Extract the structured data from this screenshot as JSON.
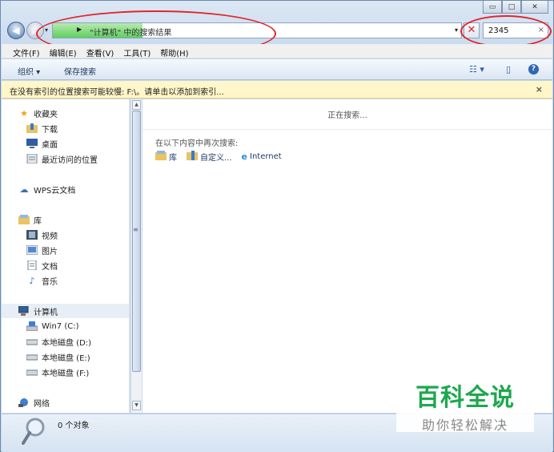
{
  "window": {
    "caption_minimize": "▭",
    "caption_maximize": "□",
    "caption_close": "✕"
  },
  "address_bar": {
    "path_text": "\"计算机\" 中的搜索结果",
    "breadcrumb_arrow": "▶",
    "dropdown": "▾",
    "stop_glyph": "✕",
    "progress_fraction": 0.22
  },
  "search": {
    "value": "2345",
    "clear_glyph": "×"
  },
  "menubar": {
    "items": [
      {
        "label": "文件(F)"
      },
      {
        "label": "编辑(E)"
      },
      {
        "label": "查看(V)"
      },
      {
        "label": "工具(T)"
      },
      {
        "label": "帮助(H)"
      }
    ]
  },
  "commandbar": {
    "organize": "组织 ▾",
    "save_search": "保存搜索",
    "view_glyph": "☷ ▾",
    "pane_glyph": "▯",
    "help_glyph": "?"
  },
  "infobar": {
    "text": "在没有索引的位置搜索可能较慢: F:\\。请单击以添加到索引...",
    "close": "×"
  },
  "nav_pane": {
    "favorites": {
      "label": "收藏夹",
      "icon": "star-icon"
    },
    "favorite_items": [
      {
        "label": "下载",
        "icon": "downloads-folder-icon"
      },
      {
        "label": "桌面",
        "icon": "desktop-icon"
      },
      {
        "label": "最近访问的位置",
        "icon": "recent-places-icon"
      }
    ],
    "wps": {
      "label": "WPS云文档",
      "icon": "cloud-icon"
    },
    "library": {
      "label": "库",
      "icon": "library-icon"
    },
    "library_items": [
      {
        "label": "视频",
        "icon": "video-library-icon"
      },
      {
        "label": "图片",
        "icon": "pictures-library-icon"
      },
      {
        "label": "文档",
        "icon": "documents-library-icon"
      },
      {
        "label": "音乐",
        "icon": "music-library-icon"
      }
    ],
    "computer": {
      "label": "计算机",
      "icon": "computer-icon"
    },
    "drives": [
      {
        "label": "Win7 (C:)",
        "icon": "system-drive-icon"
      },
      {
        "label": "本地磁盘 (D:)",
        "icon": "local-disk-icon"
      },
      {
        "label": "本地磁盘 (E:)",
        "icon": "local-disk-icon"
      },
      {
        "label": "本地磁盘 (F:)",
        "icon": "local-disk-icon"
      }
    ],
    "network": {
      "label": "网络",
      "icon": "network-icon"
    }
  },
  "content": {
    "searching_text": "正在搜索...",
    "search_again_label": "在以下内容中再次搜索:",
    "search_again_items": [
      {
        "label": "库",
        "icon": "library-icon"
      },
      {
        "label": "自定义...",
        "icon": "custom-folder-icon"
      },
      {
        "label": "Internet",
        "icon": "internet-explorer-icon"
      }
    ]
  },
  "statusbar": {
    "text": "0 个对象"
  },
  "watermark": {
    "title": "百科全说",
    "subtitle": "助你轻松解决"
  },
  "colors": {
    "annotation_red": "#e0262d",
    "progress_green": "#5fcf5e",
    "infobar_yellow": "#fff6c9",
    "watermark_green": "#1da84e"
  }
}
